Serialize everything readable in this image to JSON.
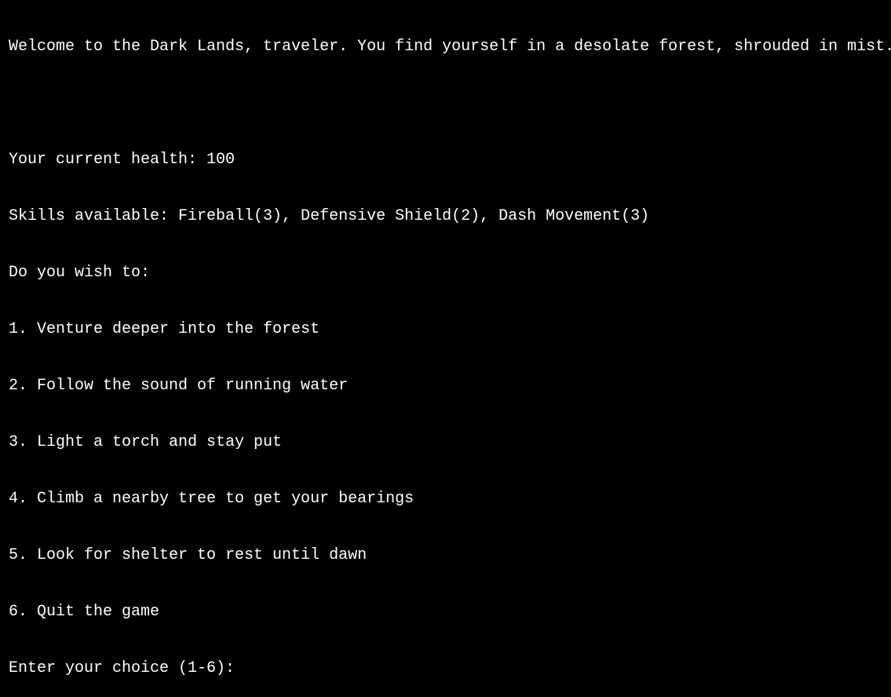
{
  "terminal": {
    "background": "#000000",
    "foreground": "#ffffff",
    "intro": "Welcome to the Dark Lands, traveler. You find yourself in a desolate forest, shrouded in mist.",
    "health_line": "Your current health: 100",
    "skills_line": "Skills available: Fireball(3), Defensive Shield(2), Dash Movement(3)",
    "question": "Do you wish to:",
    "options": [
      "1. Venture deeper into the forest",
      "2. Follow the sound of running water",
      "3. Light a torch and stay put",
      "4. Climb a nearby tree to get your bearings",
      "5. Look for shelter to rest until dawn",
      "6. Quit the game"
    ],
    "prompt": "Enter your choice (1-6): ",
    "input_value": ""
  }
}
